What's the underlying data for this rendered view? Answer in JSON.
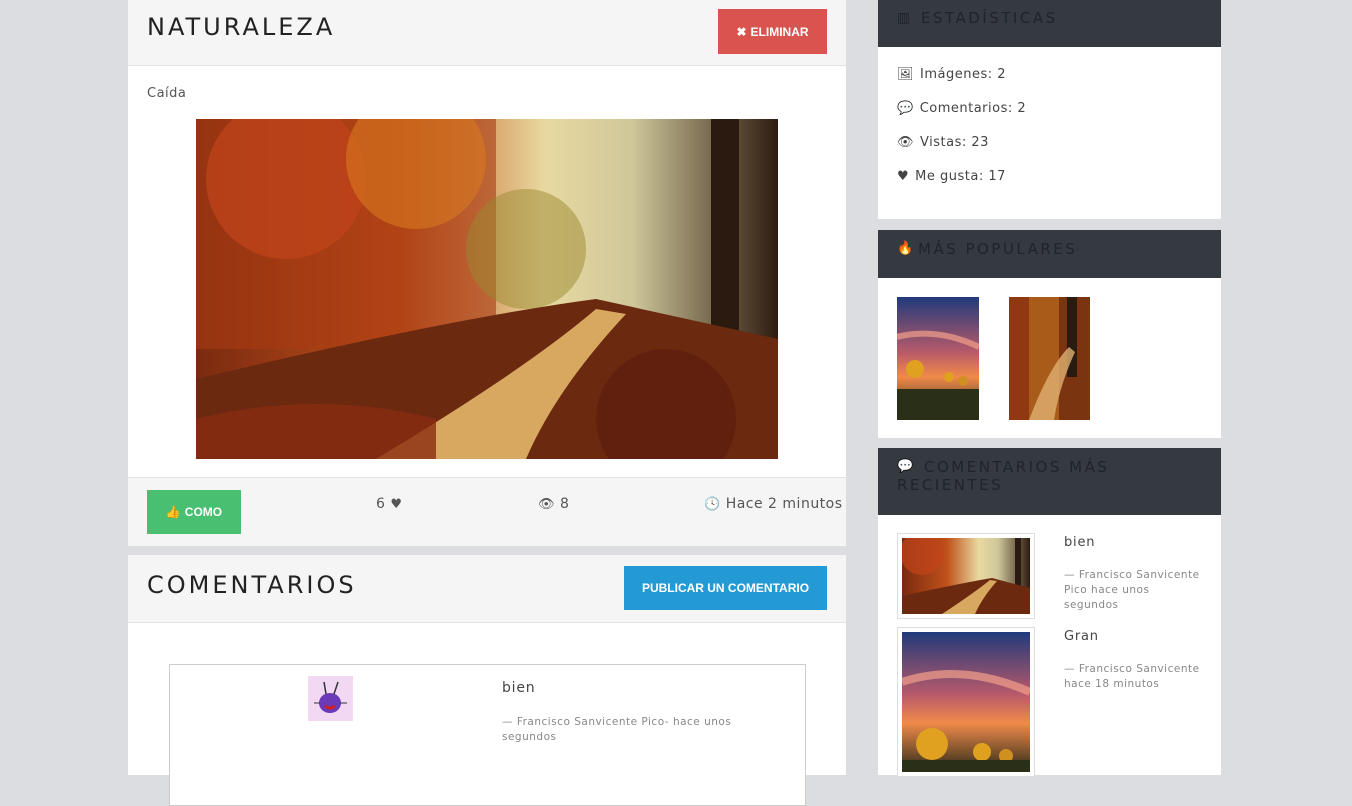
{
  "post": {
    "title": "NATURALEZA",
    "delete_label": "ELIMINAR",
    "description": "Caída",
    "like_label": "COMO",
    "likes": "6",
    "views": "8",
    "time": "Hace 2 minutos"
  },
  "comments_section": {
    "title": "COMENTARIOS",
    "publish_label": "PUBLICAR UN COMENTARIO",
    "items": [
      {
        "text": "bien",
        "meta": "—  Francisco Sanvicente Pico- hace unos segundos"
      }
    ]
  },
  "sidebar": {
    "stats": {
      "title": "ESTADÍSTICAS",
      "images": "Imágenes: 2",
      "comments": "Comentarios: 2",
      "views": "Vistas: 23",
      "likes": "Me gusta: 17"
    },
    "popular": {
      "title": "MÁS POPULARES"
    },
    "recent": {
      "title": "COMENTARIOS MÁS RECIENTES",
      "items": [
        {
          "text": "bien",
          "meta": "— Francisco Sanvicente Pico hace unos segundos"
        },
        {
          "text": "Gran",
          "meta": "— Francisco Sanvicente hace 18 minutos"
        }
      ]
    }
  },
  "icons": {
    "delete": "times-icon",
    "like": "thumbs-up-icon",
    "heart": "heart-icon",
    "eye": "eye-icon",
    "clock": "clock-icon",
    "chart": "bar-chart-icon",
    "images": "images-icon",
    "comments": "comments-icon",
    "fire": "fire-icon"
  },
  "colors": {
    "danger": "#d9534f",
    "success": "#48bf71",
    "primary": "#239ad3",
    "sidebar_header": "#343a40"
  }
}
